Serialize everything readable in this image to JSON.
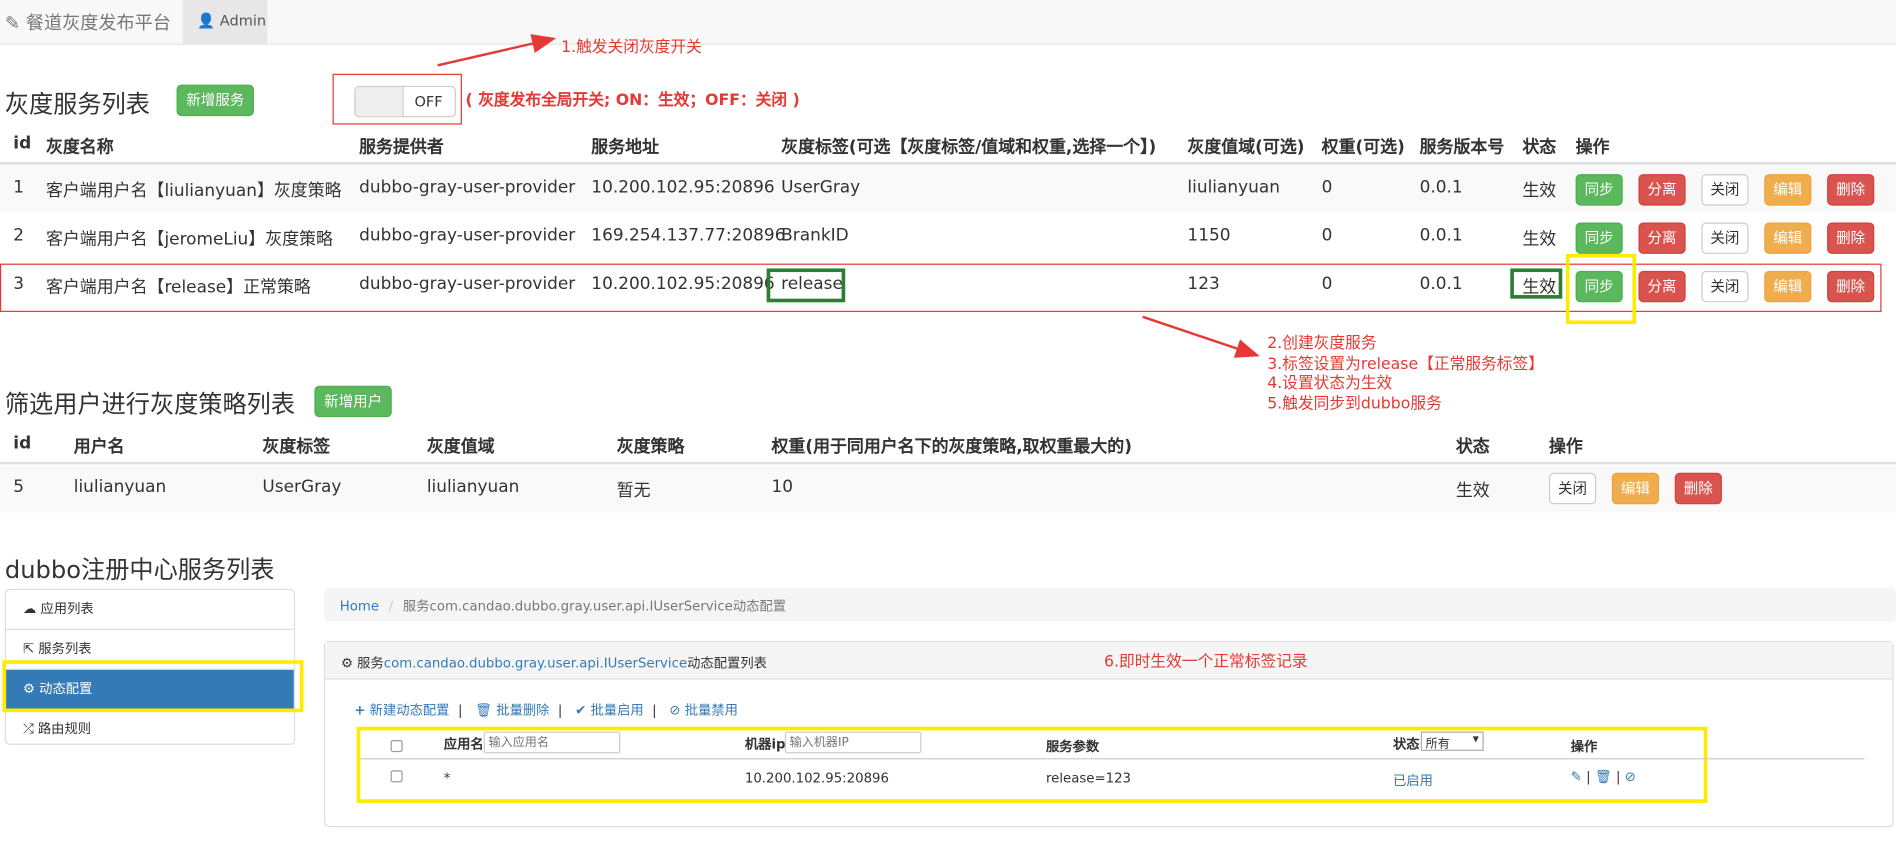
{
  "navbar": {
    "brand": "餐道灰度发布平台",
    "user": "Admin"
  },
  "annotations": {
    "a1": "1.触发关闭灰度开关",
    "a2": [
      "2.创建灰度服务",
      "3.标签设置为release【正常服务标签】",
      "4.设置状态为生效",
      "5.触发同步到dubbo服务"
    ],
    "a6": "6.即时生效一个正常标签记录",
    "switch_note": "( 灰度发布全局开关; ON：生效；OFF：关闭 )"
  },
  "gray_service": {
    "title": "灰度服务列表",
    "add_btn": "新增服务",
    "switch_label": "OFF",
    "headers": [
      "id",
      "灰度名称",
      "服务提供者",
      "服务地址",
      "灰度标签(可选【灰度标签/值域和权重,选择一个】)",
      "灰度值域(可选)",
      "权重(可选)",
      "服务版本号",
      "状态",
      "操作"
    ],
    "rows": [
      {
        "id": "1",
        "name": "客户端用户名【liulianyuan】灰度策略",
        "provider": "dubbo-gray-user-provider",
        "addr": "10.200.102.95:20896",
        "tag": "UserGray",
        "range": "liulianyuan",
        "weight": "0",
        "version": "0.0.1",
        "status": "生效"
      },
      {
        "id": "2",
        "name": "客户端用户名【jeromeLiu】灰度策略",
        "provider": "dubbo-gray-user-provider",
        "addr": "169.254.137.77:20896",
        "tag": "BrankID",
        "range": "1150",
        "weight": "0",
        "version": "0.0.1",
        "status": "生效"
      },
      {
        "id": "3",
        "name": "客户端用户名【release】正常策略",
        "provider": "dubbo-gray-user-provider",
        "addr": "10.200.102.95:20896",
        "tag": "release",
        "range": "123",
        "weight": "0",
        "version": "0.0.1",
        "status": "生效"
      }
    ],
    "actions": [
      "同步",
      "分离",
      "关闭",
      "编辑",
      "删除"
    ]
  },
  "user_strategy": {
    "title": "筛选用户进行灰度策略列表",
    "add_btn": "新增用户",
    "headers": [
      "id",
      "用户名",
      "灰度标签",
      "灰度值域",
      "灰度策略",
      "权重(用于同用户名下的灰度策略,取权重最大的)",
      "状态",
      "操作"
    ],
    "row": {
      "id": "5",
      "user": "liulianyuan",
      "tag": "UserGray",
      "range": "liulianyuan",
      "strategy": "暂无",
      "weight": "10",
      "status": "生效"
    },
    "actions": [
      "关闭",
      "编辑",
      "删除"
    ]
  },
  "dubbo": {
    "title": "dubbo注册中心服务列表",
    "side": [
      "应用列表",
      "服务列表",
      "动态配置",
      "路由规则"
    ],
    "breadcrumb_home": "Home",
    "breadcrumb_cur": "服务com.candao.dubbo.gray.user.api.IUserService动态配置",
    "panel_pre": "服务",
    "panel_service": "com.candao.dubbo.gray.user.api.IUserService",
    "panel_post": "动态配置列表",
    "toolbar": [
      "新建动态配置",
      "批量删除",
      "批量启用",
      "批量禁用"
    ],
    "cols": {
      "app": "应用名",
      "app_ph": "输入应用名",
      "ip": "机器ip",
      "ip_ph": "输入机器IP",
      "params": "服务参数",
      "status": "状态",
      "status_sel": "所有",
      "ops": "操作"
    },
    "row": {
      "app": "*",
      "ip": "10.200.102.95:20896",
      "params": "release=123",
      "status": "已启用"
    }
  }
}
